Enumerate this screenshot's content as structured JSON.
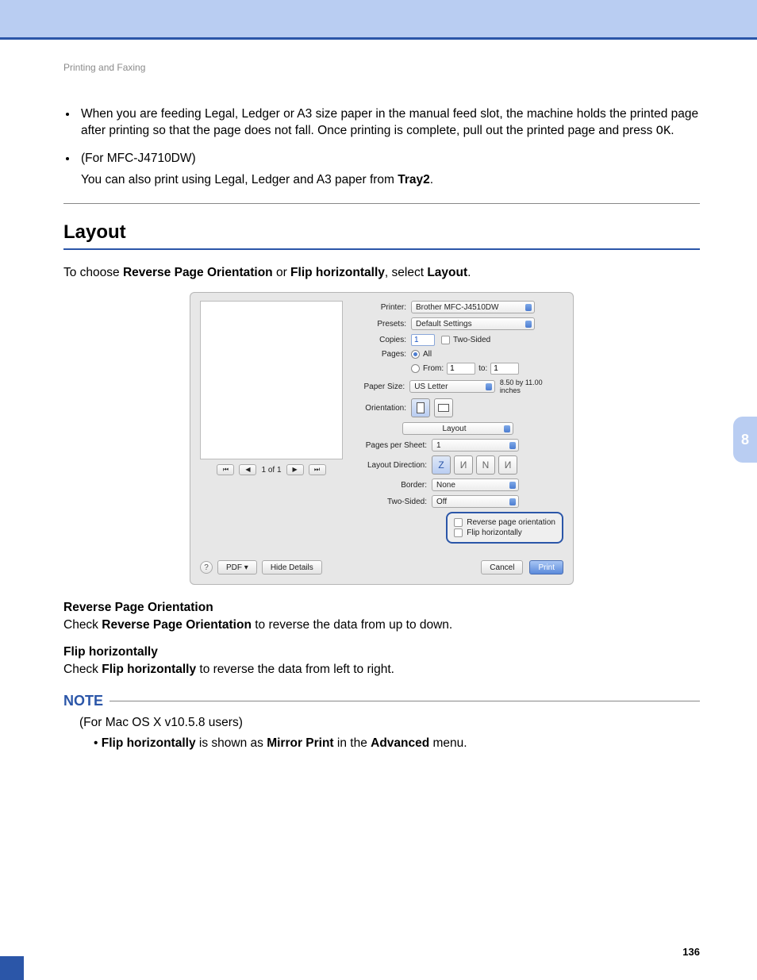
{
  "breadcrumb": "Printing and Faxing",
  "bullets": {
    "b1_pre": "When you are feeding Legal, Ledger or A3 size paper in the manual feed slot, the machine holds the printed page after printing so that the page does not fall. Once printing is complete, pull out the printed page and press ",
    "b1_key": "OK",
    "b1_post": ".",
    "b2_head": "(For MFC-J4710DW)",
    "b2_body_pre": "You can also print using Legal, Ledger and A3 paper from ",
    "b2_body_bold": "Tray2",
    "b2_body_post": "."
  },
  "section_title": "Layout",
  "intro": {
    "pre": "To choose ",
    "b1": "Reverse Page Orientation",
    "mid": " or ",
    "b2": "Flip horizontally",
    "post1": ", select ",
    "b3": "Layout",
    "post2": "."
  },
  "dlg": {
    "printer_lbl": "Printer:",
    "printer_val": "Brother MFC-J4510DW",
    "presets_lbl": "Presets:",
    "presets_val": "Default Settings",
    "copies_lbl": "Copies:",
    "copies_val": "1",
    "two_sided": "Two-Sided",
    "pages_lbl": "Pages:",
    "pages_all": "All",
    "from_lbl": "From:",
    "from_val": "1",
    "to_lbl": "to:",
    "to_val": "1",
    "paper_lbl": "Paper Size:",
    "paper_val": "US Letter",
    "paper_dim": "8.50 by 11.00 inches",
    "orient_lbl": "Orientation:",
    "pane": "Layout",
    "pps_lbl": "Pages per Sheet:",
    "pps_val": "1",
    "ldir_lbl": "Layout Direction:",
    "border_lbl": "Border:",
    "border_val": "None",
    "ts_lbl": "Two-Sided:",
    "ts_val": "Off",
    "rev": "Reverse page orientation",
    "flip": "Flip horizontally",
    "nav": "1 of 1",
    "help": "?",
    "pdf": "PDF ▾",
    "hide": "Hide Details",
    "cancel": "Cancel",
    "print": "Print"
  },
  "rpo_h": "Reverse Page Orientation",
  "rpo_t_pre": "Check ",
  "rpo_t_b": "Reverse Page Orientation",
  "rpo_t_post": " to reverse the data from up to down.",
  "fh_h": "Flip horizontally",
  "fh_t_pre": "Check ",
  "fh_t_b": "Flip horizontally",
  "fh_t_post": " to reverse the data from left to right.",
  "note_label": "NOTE",
  "note_line1": "(For Mac OS X v10.5.8 users)",
  "note_b1": "Flip horizontally",
  "note_mid1": " is shown as ",
  "note_b2": "Mirror Print",
  "note_mid2": " in the ",
  "note_b3": "Advanced",
  "note_post": " menu.",
  "side_tab": "8",
  "page_number": "136"
}
